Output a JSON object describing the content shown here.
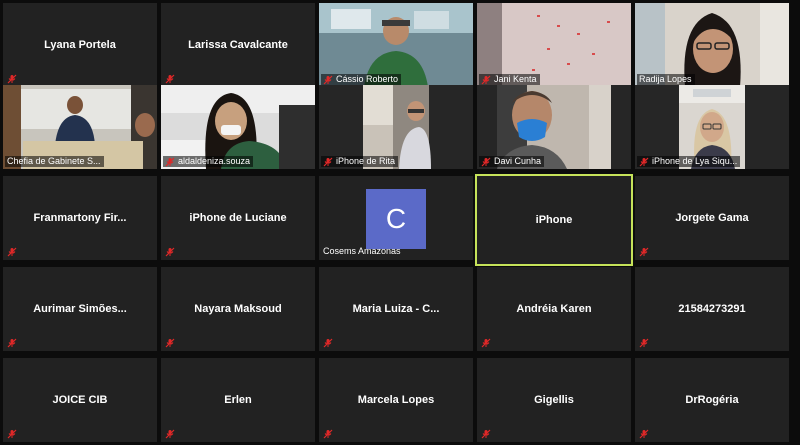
{
  "participants": [
    {
      "name": "Lyana Portela",
      "muted": true,
      "video": false
    },
    {
      "name": "Larissa Cavalcante",
      "muted": true,
      "video": false
    },
    {
      "name": "Cássio Roberto",
      "muted": true,
      "video": true
    },
    {
      "name": "Jani Kenta",
      "muted": true,
      "video": true
    },
    {
      "name": "Radija Lopes",
      "muted": false,
      "video": true
    },
    {
      "name": "Chefia de Gabinete S...",
      "muted": false,
      "video": true
    },
    {
      "name": "aldaldeniza.souza",
      "muted": true,
      "video": true
    },
    {
      "name": "iPhone de Rita",
      "muted": true,
      "video": true
    },
    {
      "name": "Davi Cunha",
      "muted": true,
      "video": true
    },
    {
      "name": "iPhone de Lya Siqu...",
      "muted": true,
      "video": true
    },
    {
      "name": "Franmartony Fir...",
      "muted": true,
      "video": false
    },
    {
      "name": "iPhone de Luciane",
      "muted": true,
      "video": false
    },
    {
      "name": "Cosems Amazonas",
      "muted": false,
      "video": false,
      "avatar_letter": "C"
    },
    {
      "name": "iPhone",
      "muted": false,
      "video": false,
      "active_speaker": true
    },
    {
      "name": "Jorgete Gama",
      "muted": true,
      "video": false
    },
    {
      "name": "Aurimar Simões...",
      "muted": true,
      "video": false
    },
    {
      "name": "Nayara Maksoud",
      "muted": true,
      "video": false
    },
    {
      "name": "Maria Luiza - C...",
      "muted": true,
      "video": false
    },
    {
      "name": "Andréia Karen",
      "muted": true,
      "video": false
    },
    {
      "name": "21584273291",
      "muted": true,
      "video": false
    },
    {
      "name": "JOICE CIB",
      "muted": true,
      "video": false
    },
    {
      "name": "Erlen",
      "muted": true,
      "video": false
    },
    {
      "name": "Marcela Lopes",
      "muted": true,
      "video": false
    },
    {
      "name": "Gigellis",
      "muted": true,
      "video": false
    },
    {
      "name": "DrRogéria",
      "muted": true,
      "video": false
    }
  ],
  "colors": {
    "tile_bg": "#222222",
    "page_bg": "#0c0c0c",
    "active_border": "#c6e35a",
    "muted_icon": "#e02828",
    "avatar_bg": "#5b6ac8"
  }
}
